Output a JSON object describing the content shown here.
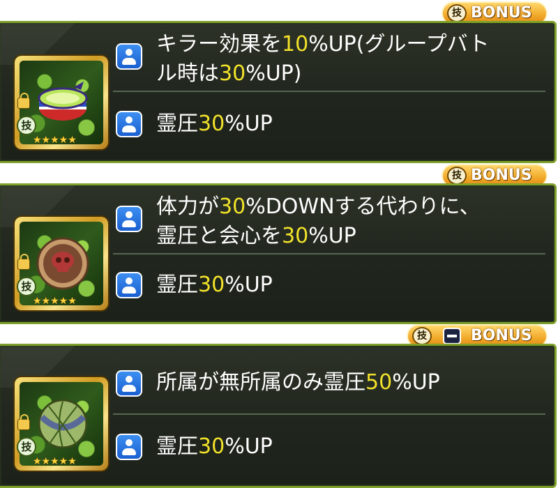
{
  "cards": [
    {
      "bonus": {
        "skill_glyph": "技",
        "label": "BONUS"
      },
      "item": "headband",
      "skill_tag": "技",
      "stars": "★★★★★",
      "rows": [
        {
          "parts": [
            "キラー効果を",
            "10",
            "%UP(グループバト"
          ],
          "line2": [
            "ル時は",
            "30",
            "%UP)"
          ]
        },
        {
          "parts": [
            "霊圧",
            "30",
            "%UP"
          ]
        }
      ]
    },
    {
      "bonus": {
        "skill_glyph": "技",
        "label": "BONUS"
      },
      "item": "skull-orb",
      "skill_tag": "技",
      "stars": "★★★★★",
      "rows": [
        {
          "parts": [
            "体力が",
            "30",
            "%DOWNする代わりに、"
          ],
          "line2": [
            "霊圧と会心を",
            "30",
            "%UP"
          ]
        },
        {
          "parts": [
            "霊圧",
            "30",
            "%UP"
          ]
        }
      ]
    },
    {
      "bonus": {
        "skill_glyph": "技",
        "label": "BONUS",
        "extra_icon": "minus-icon"
      },
      "item": "green-ball",
      "skill_tag": "技",
      "stars": "★★★★★",
      "rows": [
        {
          "parts": [
            "所属が無所属のみ霊圧",
            "50",
            "%UP"
          ]
        },
        {
          "parts": [
            "霊圧",
            "30",
            "%UP"
          ]
        }
      ]
    }
  ],
  "colors": {
    "highlight": "#f2e22a",
    "border": "#7fa12b",
    "panel": "#22281f",
    "bonus": "#f1a92a",
    "user_icon": "#2a76e6"
  }
}
